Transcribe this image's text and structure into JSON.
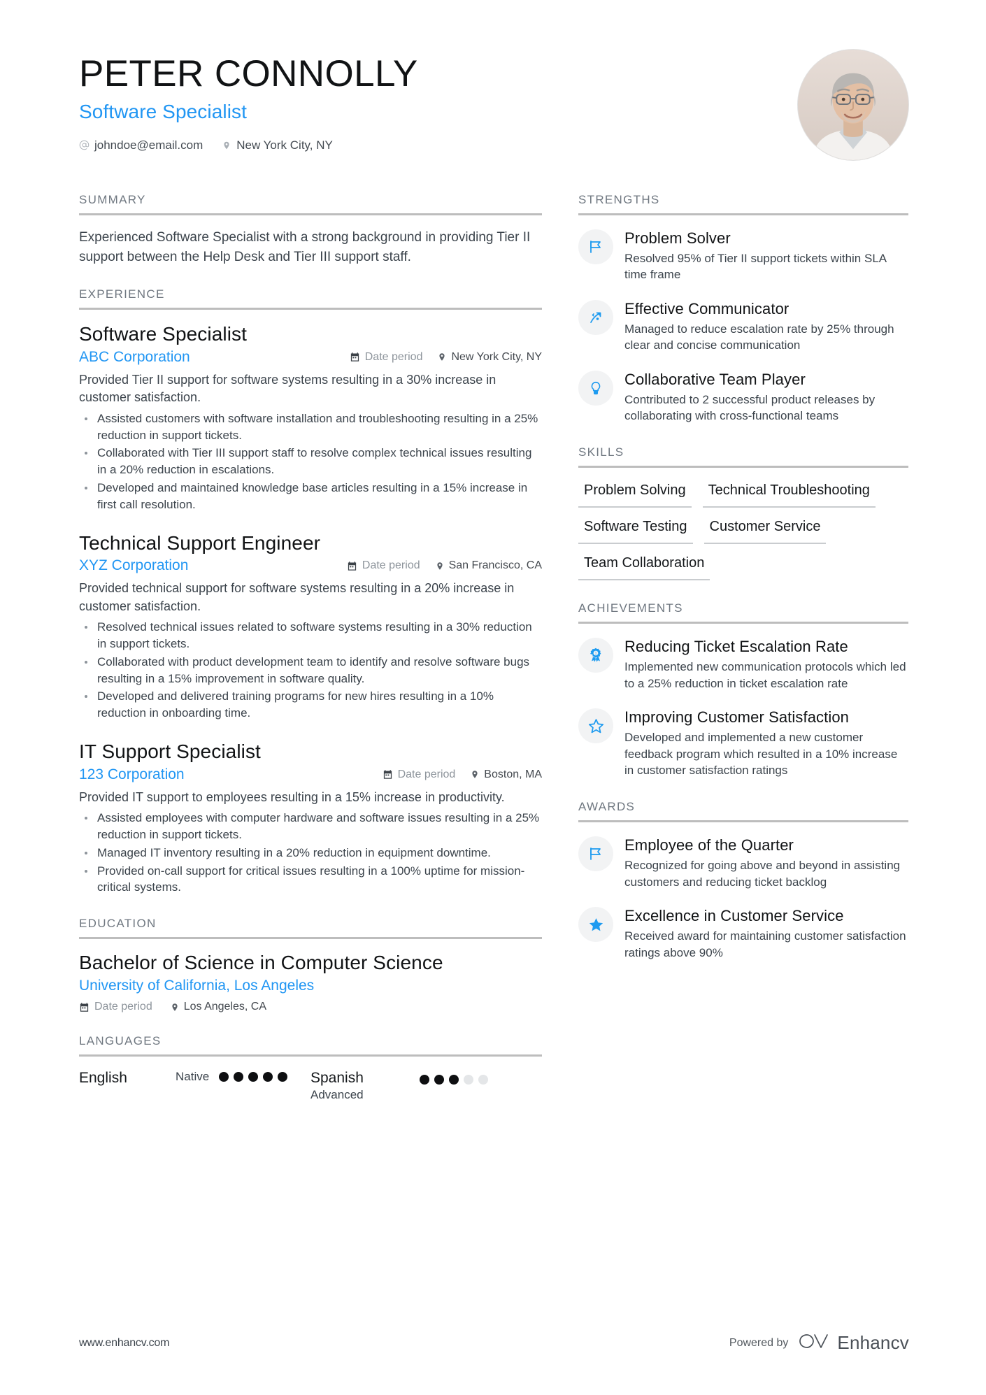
{
  "header": {
    "name": "PETER CONNOLLY",
    "title": "Software Specialist",
    "email": "johndoe@email.com",
    "location": "New York City, NY",
    "email_icon": "at-sign-icon",
    "location_icon": "map-pin-icon",
    "avatar_alt": "profile-photo"
  },
  "accent_color": "#2196f3",
  "left": {
    "summary": {
      "heading": "SUMMARY",
      "text": "Experienced Software Specialist with a strong background in providing Tier II support between the Help Desk and Tier III support staff."
    },
    "experience": {
      "heading": "EXPERIENCE",
      "items": [
        {
          "role": "Software Specialist",
          "company": "ABC Corporation",
          "date": "Date period",
          "location": "New York City, NY",
          "description": "Provided Tier II support for software systems resulting in a 30% increase in customer satisfaction.",
          "bullets": [
            "Assisted customers with software installation and troubleshooting resulting in a 25% reduction in support tickets.",
            "Collaborated with Tier III support staff to resolve complex technical issues resulting in a 20% reduction in escalations.",
            "Developed and maintained knowledge base articles resulting in a 15% increase in first call resolution."
          ]
        },
        {
          "role": "Technical Support Engineer",
          "company": "XYZ Corporation",
          "date": "Date period",
          "location": "San Francisco, CA",
          "description": "Provided technical support for software systems resulting in a 20% increase in customer satisfaction.",
          "bullets": [
            "Resolved technical issues related to software systems resulting in a 30% reduction in support tickets.",
            "Collaborated with product development team to identify and resolve software bugs resulting in a 15% improvement in software quality.",
            "Developed and delivered training programs for new hires resulting in a 10% reduction in onboarding time."
          ]
        },
        {
          "role": "IT Support Specialist",
          "company": "123 Corporation",
          "date": "Date period",
          "location": "Boston, MA",
          "description": "Provided IT support to employees resulting in a 15% increase in productivity.",
          "bullets": [
            "Assisted employees with computer hardware and software issues resulting in a 25% reduction in support tickets.",
            "Managed IT inventory resulting in a 20% reduction in equipment downtime.",
            "Provided on-call support for critical issues resulting in a 100% uptime for mission-critical systems."
          ]
        }
      ]
    },
    "education": {
      "heading": "EDUCATION",
      "degree": "Bachelor of Science in Computer Science",
      "school": "University of California, Los Angeles",
      "date": "Date period",
      "location": "Los Angeles, CA"
    },
    "languages": {
      "heading": "LANGUAGES",
      "items": [
        {
          "name": "English",
          "level": "Native",
          "dots_filled": 5,
          "dots_total": 5
        },
        {
          "name": "Spanish",
          "level": "Advanced",
          "dots_filled": 3,
          "dots_total": 5
        }
      ]
    }
  },
  "right": {
    "strengths": {
      "heading": "STRENGTHS",
      "items": [
        {
          "icon": "flag-icon",
          "title": "Problem Solver",
          "description": "Resolved 95% of Tier II support tickets within SLA time frame"
        },
        {
          "icon": "trend-arrow-icon",
          "title": "Effective Communicator",
          "description": "Managed to reduce escalation rate by 25% through clear and concise communication"
        },
        {
          "icon": "lightbulb-icon",
          "title": "Collaborative Team Player",
          "description": "Contributed to 2 successful product releases by collaborating with cross-functional teams"
        }
      ]
    },
    "skills": {
      "heading": "SKILLS",
      "items": [
        "Problem Solving",
        "Technical Troubleshooting",
        "Software Testing",
        "Customer Service",
        "Team Collaboration"
      ]
    },
    "achievements": {
      "heading": "ACHIEVEMENTS",
      "items": [
        {
          "icon": "award-medal-icon",
          "title": "Reducing Ticket Escalation Rate",
          "description": "Implemented new communication protocols which led to a 25% reduction in ticket escalation rate"
        },
        {
          "icon": "star-outline-icon",
          "title": "Improving Customer Satisfaction",
          "description": "Developed and implemented a new customer feedback program which resulted in a 10% increase in customer satisfaction ratings"
        }
      ]
    },
    "awards": {
      "heading": "AWARDS",
      "items": [
        {
          "icon": "flag-icon",
          "title": "Employee of the Quarter",
          "description": "Recognized for going above and beyond in assisting customers and reducing ticket backlog"
        },
        {
          "icon": "star-filled-icon",
          "title": "Excellence in Customer Service",
          "description": "Received award for maintaining customer satisfaction ratings above 90%"
        }
      ]
    }
  },
  "footer": {
    "url": "www.enhancv.com",
    "powered_by": "Powered by",
    "brand": "Enhancv"
  }
}
